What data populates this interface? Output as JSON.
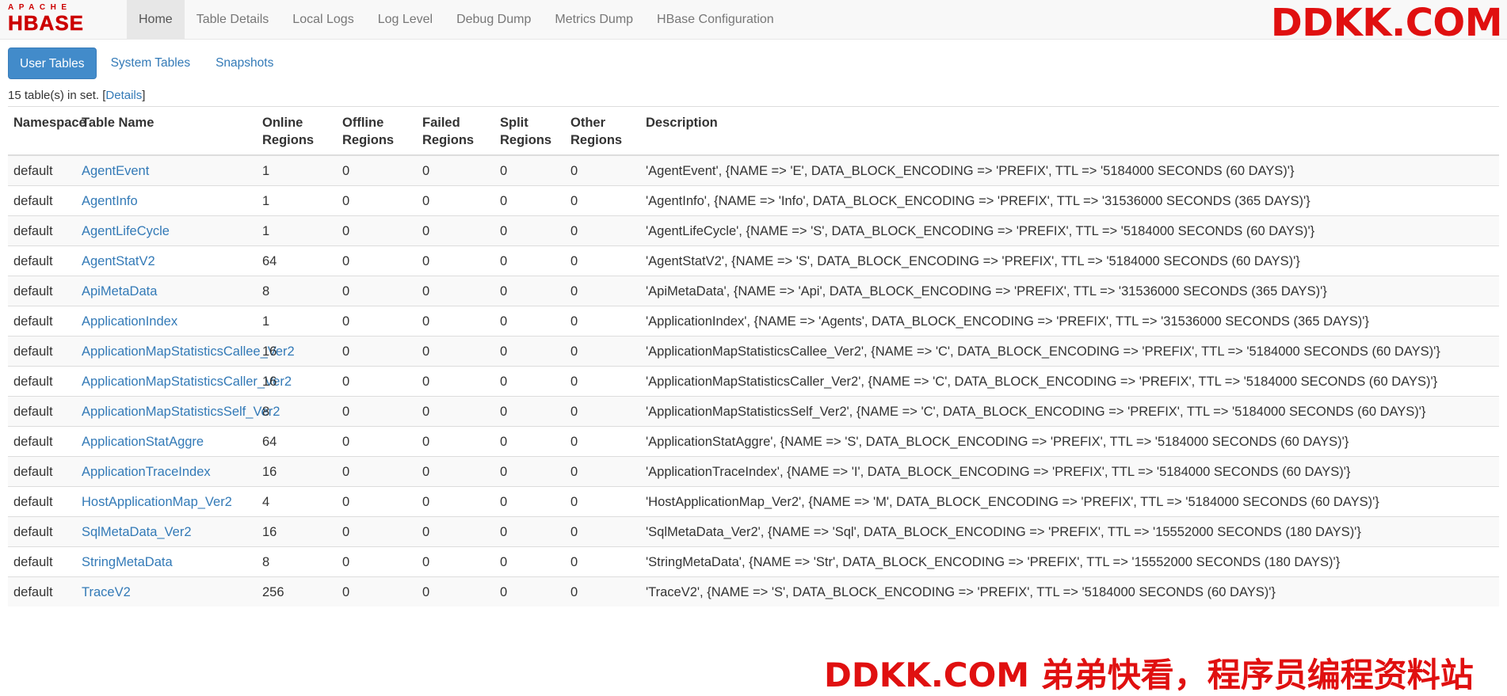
{
  "logo": {
    "top": "APACHE",
    "main": "HBASE"
  },
  "nav": [
    {
      "label": "Home",
      "active": true
    },
    {
      "label": "Table Details"
    },
    {
      "label": "Local Logs"
    },
    {
      "label": "Log Level"
    },
    {
      "label": "Debug Dump"
    },
    {
      "label": "Metrics Dump"
    },
    {
      "label": "HBase Configuration"
    }
  ],
  "tabs": [
    {
      "label": "User Tables",
      "active": true
    },
    {
      "label": "System Tables"
    },
    {
      "label": "Snapshots"
    }
  ],
  "summary": {
    "text": "15 table(s) in set. [",
    "link": "Details",
    "end": "]"
  },
  "table": {
    "headers": [
      "Namespace",
      "Table Name",
      "Online Regions",
      "Offline Regions",
      "Failed Regions",
      "Split Regions",
      "Other Regions",
      "Description"
    ],
    "rows": [
      [
        "default",
        "AgentEvent",
        "1",
        "0",
        "0",
        "0",
        "0",
        "'AgentEvent', {NAME => 'E', DATA_BLOCK_ENCODING => 'PREFIX', TTL => '5184000 SECONDS (60 DAYS)'}"
      ],
      [
        "default",
        "AgentInfo",
        "1",
        "0",
        "0",
        "0",
        "0",
        "'AgentInfo', {NAME => 'Info', DATA_BLOCK_ENCODING => 'PREFIX', TTL => '31536000 SECONDS (365 DAYS)'}"
      ],
      [
        "default",
        "AgentLifeCycle",
        "1",
        "0",
        "0",
        "0",
        "0",
        "'AgentLifeCycle', {NAME => 'S', DATA_BLOCK_ENCODING => 'PREFIX', TTL => '5184000 SECONDS (60 DAYS)'}"
      ],
      [
        "default",
        "AgentStatV2",
        "64",
        "0",
        "0",
        "0",
        "0",
        "'AgentStatV2', {NAME => 'S', DATA_BLOCK_ENCODING => 'PREFIX', TTL => '5184000 SECONDS (60 DAYS)'}"
      ],
      [
        "default",
        "ApiMetaData",
        "8",
        "0",
        "0",
        "0",
        "0",
        "'ApiMetaData', {NAME => 'Api', DATA_BLOCK_ENCODING => 'PREFIX', TTL => '31536000 SECONDS (365 DAYS)'}"
      ],
      [
        "default",
        "ApplicationIndex",
        "1",
        "0",
        "0",
        "0",
        "0",
        "'ApplicationIndex', {NAME => 'Agents', DATA_BLOCK_ENCODING => 'PREFIX', TTL => '31536000 SECONDS (365 DAYS)'}"
      ],
      [
        "default",
        "ApplicationMapStatisticsCallee_Ver2",
        "16",
        "0",
        "0",
        "0",
        "0",
        "'ApplicationMapStatisticsCallee_Ver2', {NAME => 'C', DATA_BLOCK_ENCODING => 'PREFIX', TTL => '5184000 SECONDS (60 DAYS)'}"
      ],
      [
        "default",
        "ApplicationMapStatisticsCaller_Ver2",
        "16",
        "0",
        "0",
        "0",
        "0",
        "'ApplicationMapStatisticsCaller_Ver2', {NAME => 'C', DATA_BLOCK_ENCODING => 'PREFIX', TTL => '5184000 SECONDS (60 DAYS)'}"
      ],
      [
        "default",
        "ApplicationMapStatisticsSelf_Ver2",
        "8",
        "0",
        "0",
        "0",
        "0",
        "'ApplicationMapStatisticsSelf_Ver2', {NAME => 'C', DATA_BLOCK_ENCODING => 'PREFIX', TTL => '5184000 SECONDS (60 DAYS)'}"
      ],
      [
        "default",
        "ApplicationStatAggre",
        "64",
        "0",
        "0",
        "0",
        "0",
        "'ApplicationStatAggre', {NAME => 'S', DATA_BLOCK_ENCODING => 'PREFIX', TTL => '5184000 SECONDS (60 DAYS)'}"
      ],
      [
        "default",
        "ApplicationTraceIndex",
        "16",
        "0",
        "0",
        "0",
        "0",
        "'ApplicationTraceIndex', {NAME => 'I', DATA_BLOCK_ENCODING => 'PREFIX', TTL => '5184000 SECONDS (60 DAYS)'}"
      ],
      [
        "default",
        "HostApplicationMap_Ver2",
        "4",
        "0",
        "0",
        "0",
        "0",
        "'HostApplicationMap_Ver2', {NAME => 'M', DATA_BLOCK_ENCODING => 'PREFIX', TTL => '5184000 SECONDS (60 DAYS)'}"
      ],
      [
        "default",
        "SqlMetaData_Ver2",
        "16",
        "0",
        "0",
        "0",
        "0",
        "'SqlMetaData_Ver2', {NAME => 'Sql', DATA_BLOCK_ENCODING => 'PREFIX', TTL => '15552000 SECONDS (180 DAYS)'}"
      ],
      [
        "default",
        "StringMetaData",
        "8",
        "0",
        "0",
        "0",
        "0",
        "'StringMetaData', {NAME => 'Str', DATA_BLOCK_ENCODING => 'PREFIX', TTL => '15552000 SECONDS (180 DAYS)'}"
      ],
      [
        "default",
        "TraceV2",
        "256",
        "0",
        "0",
        "0",
        "0",
        "'TraceV2', {NAME => 'S', DATA_BLOCK_ENCODING => 'PREFIX', TTL => '5184000 SECONDS (60 DAYS)'}"
      ]
    ]
  },
  "watermarks": {
    "top": "DDKK.COM",
    "bottom": "DDKK.COM 弟弟快看，程序员编程资料站"
  }
}
